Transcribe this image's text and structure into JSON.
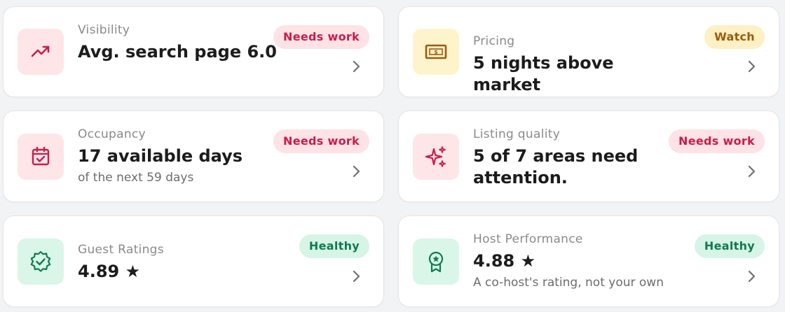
{
  "colors": {
    "page_background": "#f2f3f5",
    "needs_work_text": "#c81d4a",
    "needs_work_bg": "#fde2e6",
    "watch_text": "#9e5a0b",
    "watch_bg": "#fdf0c4",
    "healthy_text": "#107b52",
    "healthy_bg": "#d6f5e6"
  },
  "cards": [
    {
      "label": "Visibility",
      "value": "Avg. search page 6.0",
      "badge": "Needs work",
      "status": "needs-work",
      "icon": "trending-up-icon"
    },
    {
      "label": "Pricing",
      "value": "5 nights above market",
      "badge": "Watch",
      "status": "watch",
      "icon": "price-tag-icon"
    },
    {
      "label": "Occupancy",
      "value": "17 available days",
      "sub": "of the next 59 days",
      "badge": "Needs work",
      "status": "needs-work",
      "icon": "calendar-check-icon"
    },
    {
      "label": "Listing quality",
      "value": "5 of 7 areas need attention.",
      "badge": "Needs work",
      "status": "needs-work",
      "icon": "sparkles-icon"
    },
    {
      "label": "Guest Ratings",
      "value": "4.89 ★",
      "badge": "Healthy",
      "status": "healthy",
      "icon": "badge-check-icon"
    },
    {
      "label": "Host Performance",
      "value": "4.88 ★",
      "sub": "A co-host's rating, not your own",
      "badge": "Healthy",
      "status": "healthy",
      "icon": "award-ribbon-icon"
    }
  ]
}
